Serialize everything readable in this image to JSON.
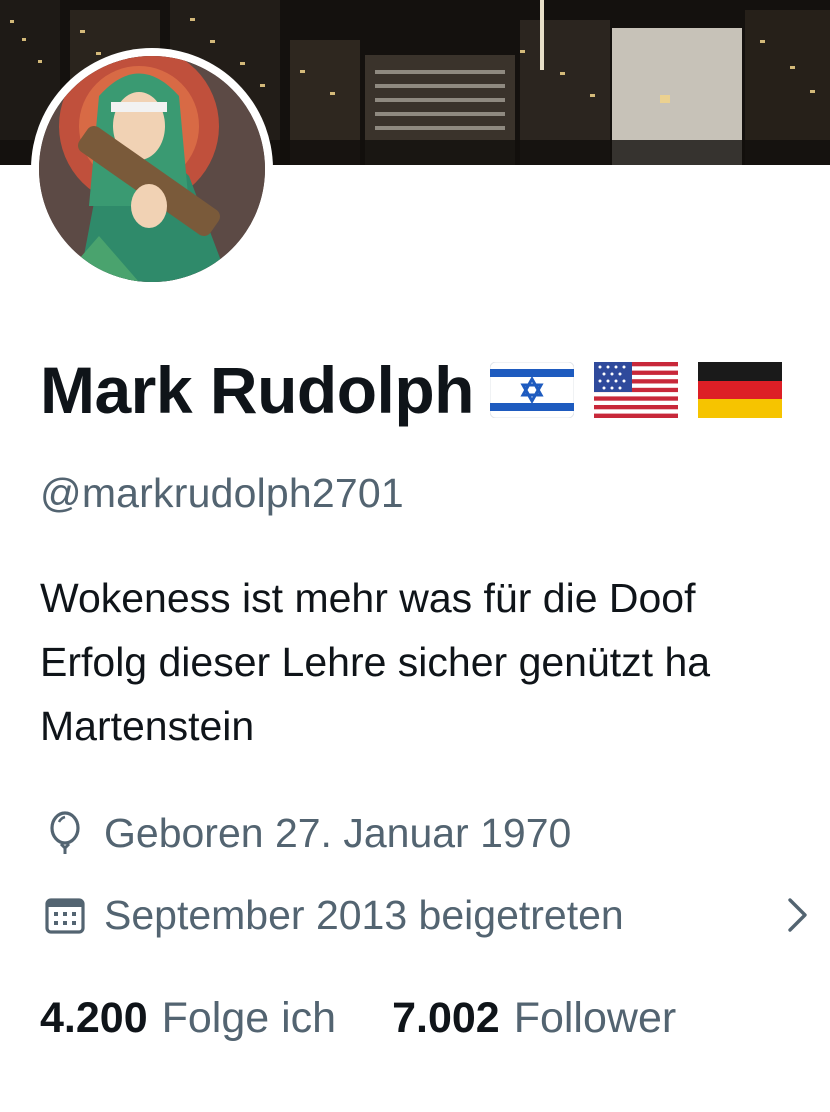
{
  "profile": {
    "display_name": "Mark Rudolph",
    "name_flags": [
      "flag-israel-icon",
      "flag-usa-icon",
      "flag-germany-icon"
    ],
    "handle": "@markrudolph2701",
    "bio_lines": [
      "Wokeness ist mehr was für die Doof",
      "Erfolg dieser Lehre sicher genützt ha",
      "Martenstein"
    ],
    "birth_text": "Geboren 27. Januar 1970",
    "joined_text": "September 2013 beigetreten",
    "following_count": "4.200",
    "following_label": "Folge ich",
    "followers_count": "7.002",
    "followers_label": "Follower"
  },
  "icons": {
    "birth": "balloon-icon",
    "joined": "calendar-icon",
    "joined_more": "chevron-right-icon"
  },
  "colors": {
    "text_primary": "#0f1419",
    "text_secondary": "#536471",
    "background": "#ffffff"
  }
}
